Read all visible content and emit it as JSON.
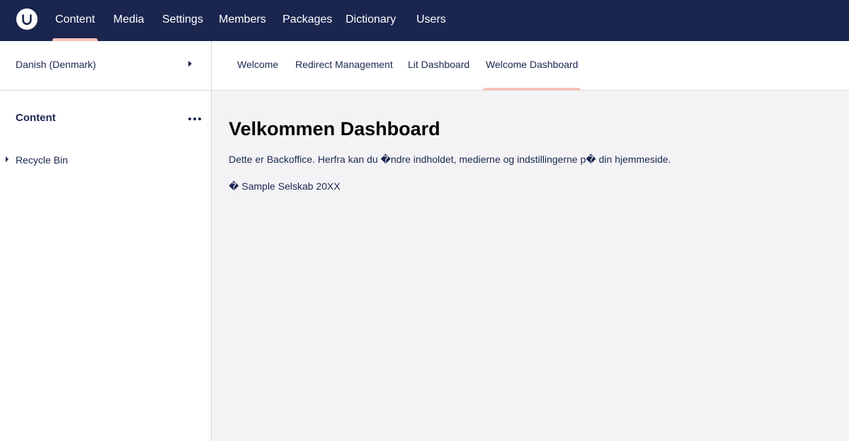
{
  "header": {
    "logo_icon": "umbraco-logo-icon",
    "sections": [
      {
        "label": "Content",
        "active": true
      },
      {
        "label": "Media"
      },
      {
        "label": "Settings"
      },
      {
        "label": "Members"
      },
      {
        "label": "Packages"
      },
      {
        "label": "Dictionary"
      },
      {
        "label": "Users"
      }
    ]
  },
  "sidebar": {
    "culture": "Danish (Denmark)",
    "tree_title": "Content",
    "more_icon": "ellipsis-icon",
    "items": [
      {
        "label": "Recycle Bin"
      }
    ]
  },
  "dashboard_tabs": [
    {
      "label": "Welcome"
    },
    {
      "label": "Redirect Management"
    },
    {
      "label": "Lit Dashboard"
    },
    {
      "label": "Welcome Dashboard",
      "active": true
    }
  ],
  "main": {
    "title": "Velkommen Dashboard",
    "intro": "Dette er Backoffice. Herfra kan du �ndre indholdet, medierne og indstillingerne p� din hjemmeside.",
    "copyright": "� Sample Selskab 20XX"
  },
  "colors": {
    "header_bg": "#1b264f",
    "accent": "#f5c1bc",
    "main_bg": "#f3f3f5"
  }
}
